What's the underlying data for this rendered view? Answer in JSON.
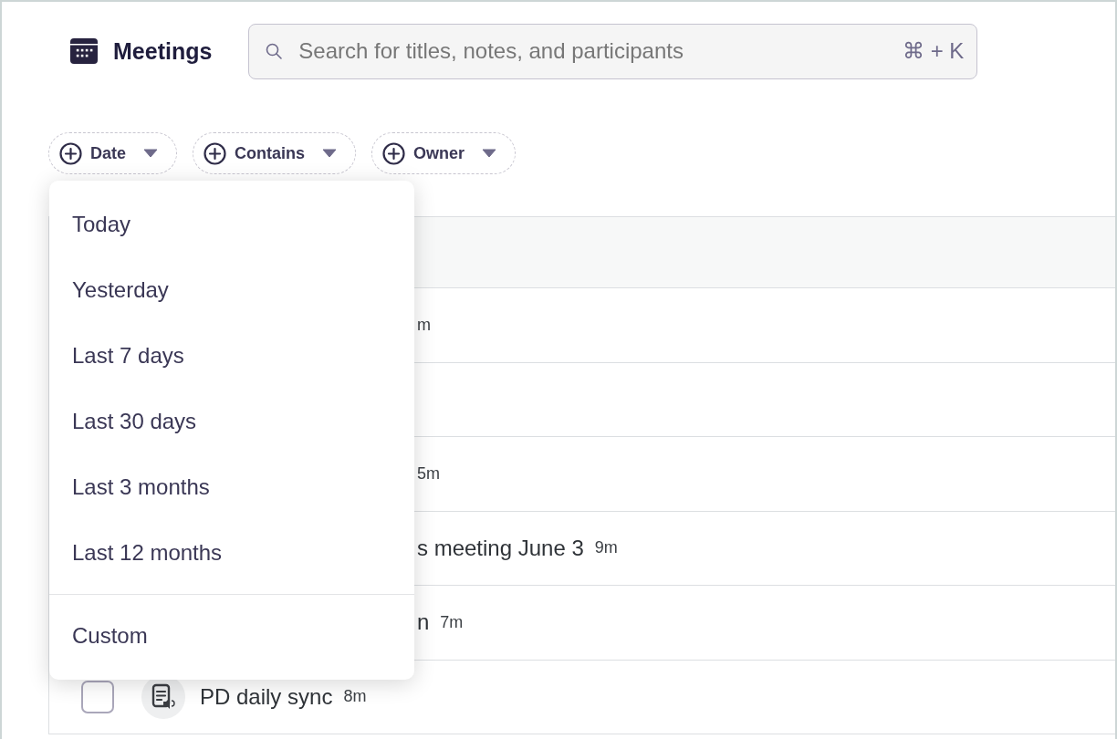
{
  "header": {
    "title": "Meetings",
    "search": {
      "placeholder": "Search for titles, notes, and participants",
      "shortcut": "⌘ + K"
    }
  },
  "filters": [
    {
      "label": "Date"
    },
    {
      "label": "Contains"
    },
    {
      "label": "Owner"
    }
  ],
  "rows": [
    {
      "kind": "partial",
      "duration": "m"
    },
    {
      "kind": "partial"
    },
    {
      "kind": "partial",
      "duration": "5m"
    },
    {
      "kind": "partial",
      "title": "s meeting June 3",
      "duration": "9m"
    },
    {
      "kind": "partial",
      "title": "n",
      "duration": "7m"
    },
    {
      "kind": "full",
      "checked": false,
      "title": "PD daily sync",
      "duration": "8m"
    }
  ],
  "date_menu": {
    "groups": [
      [
        "Today",
        "Yesterday",
        "Last 7 days",
        "Last 30 days",
        "Last 3 months",
        "Last 12 months"
      ],
      [
        "Custom"
      ]
    ]
  }
}
